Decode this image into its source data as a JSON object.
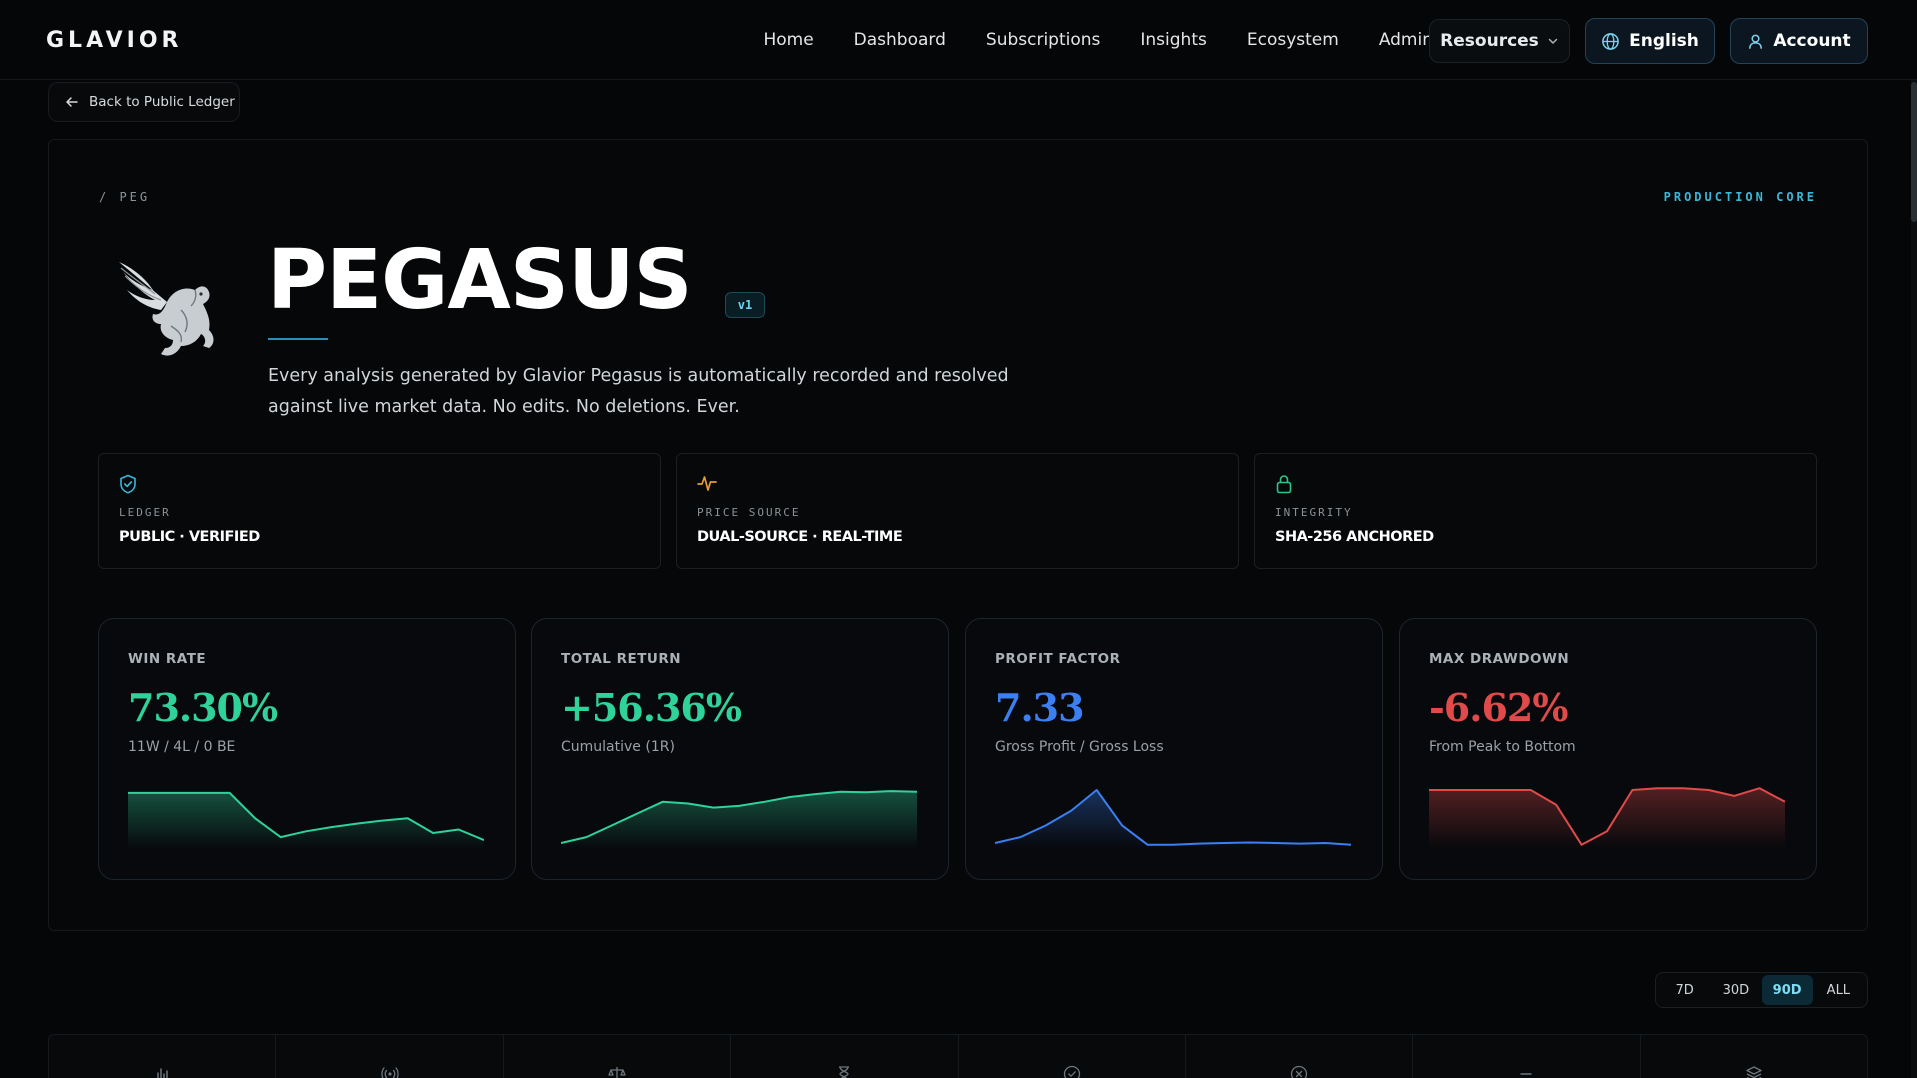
{
  "nav": {
    "logo": "GLAVIOR",
    "links": [
      "Home",
      "Dashboard",
      "Subscriptions",
      "Insights",
      "Ecosystem",
      "Admin"
    ],
    "resources": "Resources",
    "language": "English",
    "account": "Account"
  },
  "back_label": "Back to Public Ledger",
  "hero": {
    "breadcrumb": "/ PEG",
    "environment": "PRODUCTION CORE",
    "title": "PEGASUS",
    "version": "v1",
    "tagline": "Every analysis generated by Glavior Pegasus is automatically recorded and resolved against live market data. No edits. No deletions. Ever."
  },
  "info_cards": [
    {
      "icon": "shield-check-icon",
      "label": "LEDGER",
      "value": "PUBLIC · VERIFIED",
      "color": "#3bb8d9"
    },
    {
      "icon": "pulse-icon",
      "label": "PRICE SOURCE",
      "value": "DUAL-SOURCE · REAL-TIME",
      "color": "#e3a02c"
    },
    {
      "icon": "lock-icon",
      "label": "INTEGRITY",
      "value": "SHA-256 ANCHORED",
      "color": "#2ec48a"
    }
  ],
  "metrics": [
    {
      "label": "WIN RATE",
      "value": "73.30%",
      "sub": "11W / 4L / 0 BE",
      "color": "#2fd39a",
      "spark": [
        0.9,
        0.9,
        0.9,
        0.9,
        0.9,
        0.47,
        0.15,
        0.25,
        0.32,
        0.38,
        0.43,
        0.47,
        0.22,
        0.28,
        0.1
      ]
    },
    {
      "label": "TOTAL RETURN",
      "value": "+56.36%",
      "sub": "Cumulative (1R)",
      "color": "#2fd39a",
      "spark": [
        0.05,
        0.15,
        0.35,
        0.55,
        0.75,
        0.72,
        0.65,
        0.68,
        0.75,
        0.83,
        0.88,
        0.92,
        0.91,
        0.93,
        0.92
      ]
    },
    {
      "label": "PROFIT FACTOR",
      "value": "7.33",
      "sub": "Gross Profit / Gross Loss",
      "color": "#3b7ff2",
      "spark": [
        0.05,
        0.15,
        0.35,
        0.6,
        0.95,
        0.35,
        0.02,
        0.02,
        0.04,
        0.05,
        0.06,
        0.05,
        0.04,
        0.05,
        0.02
      ]
    },
    {
      "label": "MAX DRAWDOWN",
      "value": "-6.62%",
      "sub": "From Peak to Bottom",
      "color": "#e04a4a",
      "spark": [
        0.95,
        0.95,
        0.95,
        0.95,
        0.95,
        0.7,
        0.02,
        0.25,
        0.95,
        0.98,
        0.98,
        0.95,
        0.85,
        0.98,
        0.75
      ]
    }
  ],
  "range": {
    "options": [
      "7D",
      "30D",
      "90D",
      "ALL"
    ],
    "selected": "90D"
  },
  "strip_icons": [
    "bar-chart-icon",
    "broadcast-icon",
    "scale-icon",
    "hourglass-icon",
    "check-circle-icon",
    "x-circle-icon",
    "minus-icon",
    "layers-icon"
  ]
}
